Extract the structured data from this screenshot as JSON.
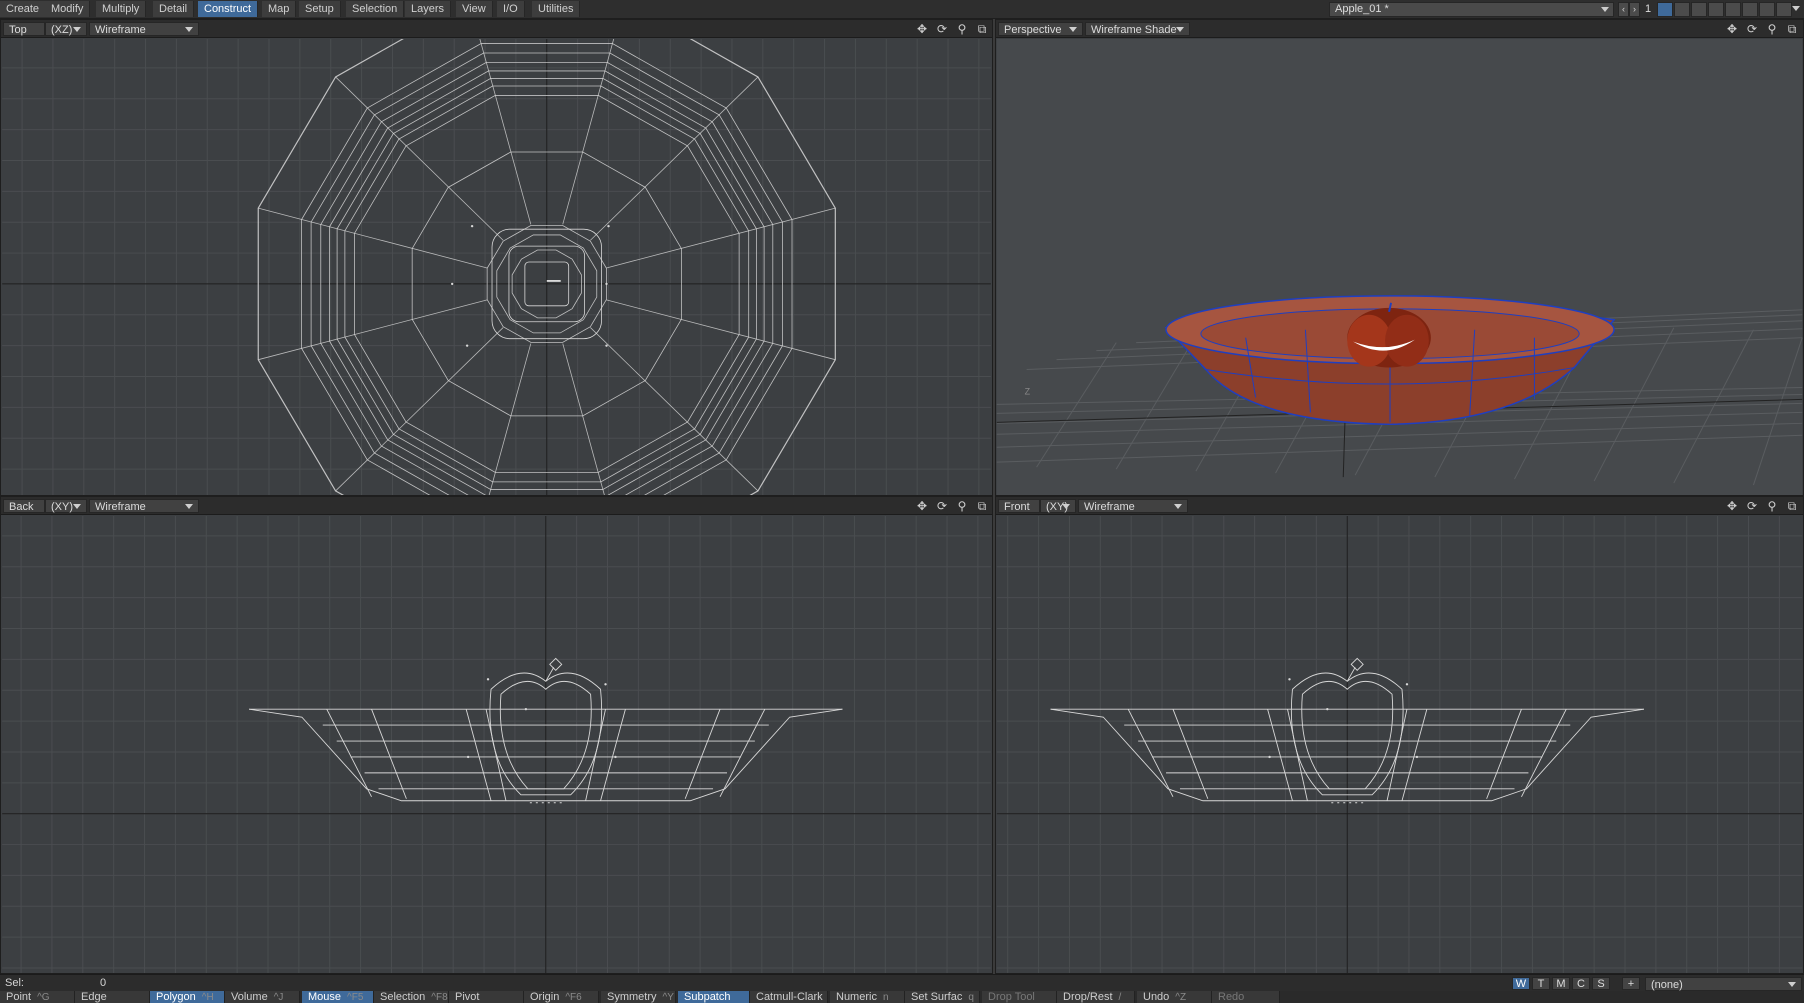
{
  "menu": {
    "tabs": [
      "Create",
      "Modify",
      "Multiply",
      "Detail",
      "Construct",
      "Map",
      "Setup",
      "Selection",
      "Layers",
      "View",
      "I/O",
      "Utilities"
    ],
    "active_tab": "Construct"
  },
  "object_selector": "Apple_01 *",
  "layer_number": "1",
  "viewports": {
    "top_left": {
      "view": "Top",
      "axes": "(XZ)",
      "mode": "Wireframe"
    },
    "top_right": {
      "view": "Perspective",
      "mode": "Wireframe Shade"
    },
    "bottom_left": {
      "view": "Back",
      "axes": "(XY)",
      "mode": "Wireframe"
    },
    "bottom_right": {
      "view": "Front",
      "axes": "(XY)",
      "mode": "Wireframe"
    }
  },
  "status": {
    "sel_label": "Sel:",
    "sel_value": "0"
  },
  "mode_buttons": [
    "W",
    "T",
    "M",
    "C",
    "S",
    "+"
  ],
  "surface_select": "(none)",
  "toolbar": [
    {
      "label": "Point",
      "shortcut": "^G"
    },
    {
      "label": "Edge",
      "shortcut": ""
    },
    {
      "label": "Polygon",
      "shortcut": "^H"
    },
    {
      "label": "Volume",
      "shortcut": "^J"
    },
    {
      "label": "Mouse",
      "shortcut": "^F5"
    },
    {
      "label": "Selection",
      "shortcut": "^F8"
    },
    {
      "label": "Pivot",
      "shortcut": ""
    },
    {
      "label": "Origin",
      "shortcut": "^F6"
    },
    {
      "label": "Symmetry",
      "shortcut": "^Y"
    },
    {
      "label": "Subpatch",
      "shortcut": ""
    },
    {
      "label": "Catmull-Clark",
      "shortcut": ""
    },
    {
      "label": "Numeric",
      "shortcut": "n"
    },
    {
      "label": "Set Surfac",
      "shortcut": "q"
    },
    {
      "label": "Drop Tool",
      "shortcut": ""
    },
    {
      "label": "Drop/Rest",
      "shortcut": "/"
    },
    {
      "label": "Undo",
      "shortcut": "^Z"
    },
    {
      "label": "Redo",
      "shortcut": ""
    }
  ],
  "colors": {
    "active_tab": "#3f6a9a",
    "bowl": "#a04b33",
    "wire": "#d8d8d8",
    "highlight": "#1f3fc0"
  }
}
